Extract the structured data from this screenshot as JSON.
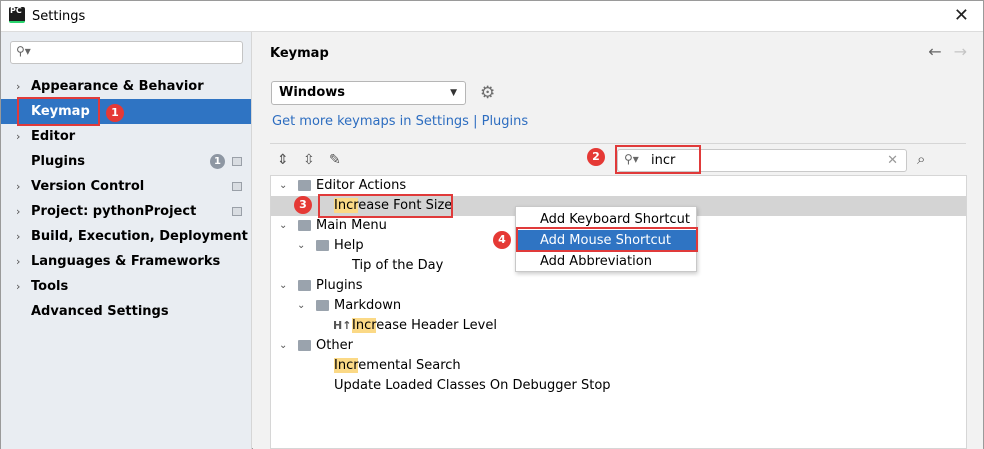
{
  "window": {
    "title": "Settings",
    "app_icon_text": "PC"
  },
  "sidebar": {
    "search_placeholder": "",
    "items": [
      {
        "label": "Appearance & Behavior",
        "expandable": true
      },
      {
        "label": "Keymap",
        "expandable": false,
        "selected": true
      },
      {
        "label": "Editor",
        "expandable": true
      },
      {
        "label": "Plugins",
        "expandable": false,
        "badge": "1"
      },
      {
        "label": "Version Control",
        "expandable": true
      },
      {
        "label": "Project: pythonProject",
        "expandable": true
      },
      {
        "label": "Build, Execution, Deployment",
        "expandable": true
      },
      {
        "label": "Languages & Frameworks",
        "expandable": true
      },
      {
        "label": "Tools",
        "expandable": true
      },
      {
        "label": "Advanced Settings",
        "expandable": false
      }
    ]
  },
  "main": {
    "heading": "Keymap",
    "keymap_select": "Windows",
    "more_link": "Get more keymaps in Settings | Plugins",
    "filter_value": "incr",
    "tree": [
      {
        "label": "Editor Actions"
      },
      {
        "highlight": "Incr",
        "rest": "ease Font Size"
      },
      {
        "label": "Main Menu"
      },
      {
        "label": "Help"
      },
      {
        "label": "Tip of the Day"
      },
      {
        "label": "Plugins"
      },
      {
        "label": "Markdown"
      },
      {
        "highlight": "Incr",
        "rest": "ease Header Level"
      },
      {
        "label": "Other"
      },
      {
        "highlight": "Incr",
        "rest": "emental Search"
      },
      {
        "label": "Update Loaded Classes On Debugger Stop"
      }
    ]
  },
  "context_menu": [
    "Add Keyboard Shortcut",
    "Add Mouse Shortcut",
    "Add Abbreviation"
  ],
  "callouts": [
    "1",
    "2",
    "3",
    "4"
  ],
  "colors": {
    "accent": "#2f74c3",
    "callout": "#e53935",
    "highlight": "#fbd986"
  }
}
